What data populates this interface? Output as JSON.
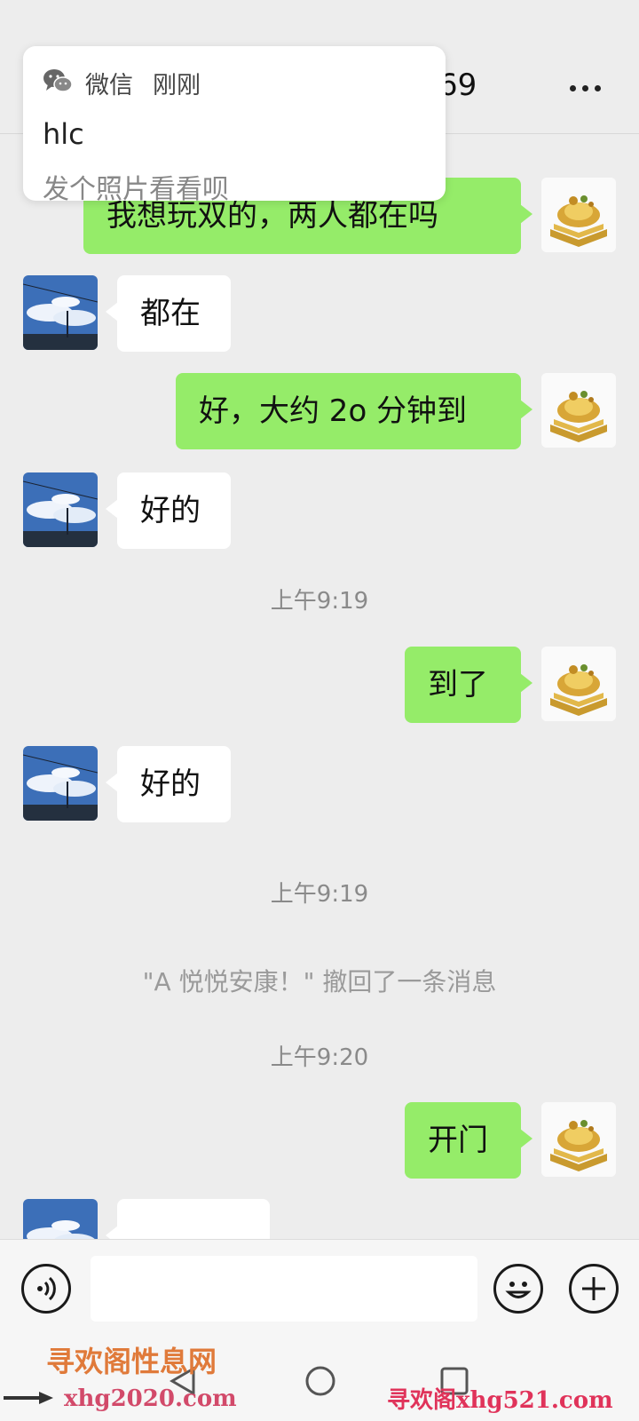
{
  "header": {
    "title_fragment": "69"
  },
  "notification": {
    "app": "微信",
    "time": "刚刚",
    "sender": "hlc",
    "message": "发个照片看看呗"
  },
  "messages": [
    {
      "text": "我想玩双的，两人都在吗"
    },
    {
      "text": "都在"
    },
    {
      "text": "好，大约 2o 分钟到"
    },
    {
      "text": "好的"
    },
    {
      "text": "到了"
    },
    {
      "text": "好的"
    },
    {
      "text": "开门"
    }
  ],
  "timestamps": [
    "上午9:19",
    "上午9:19",
    "上午9:20"
  ],
  "system": {
    "recall": "\"A 悦悦安康！\" 撤回了一条消息"
  },
  "input": {
    "placeholder": ""
  },
  "icons": {
    "voice": "voice-wave-icon",
    "emoji": "smiley-icon",
    "plus": "plus-icon",
    "more": "more-dots-icon",
    "nav_back": "triangle-back-icon",
    "nav_home": "circle-home-icon",
    "nav_recent": "square-recent-icon",
    "notif_app": "wechat-logo-icon"
  },
  "colors": {
    "sent_bubble": "#95ec69",
    "received_bubble": "#ffffff",
    "background": "#ededed"
  },
  "watermarks": {
    "top_left": "寻欢阁性息网",
    "bottom_left": "xhg2020.com",
    "bottom_right": "寻欢阁xhg521.com"
  }
}
